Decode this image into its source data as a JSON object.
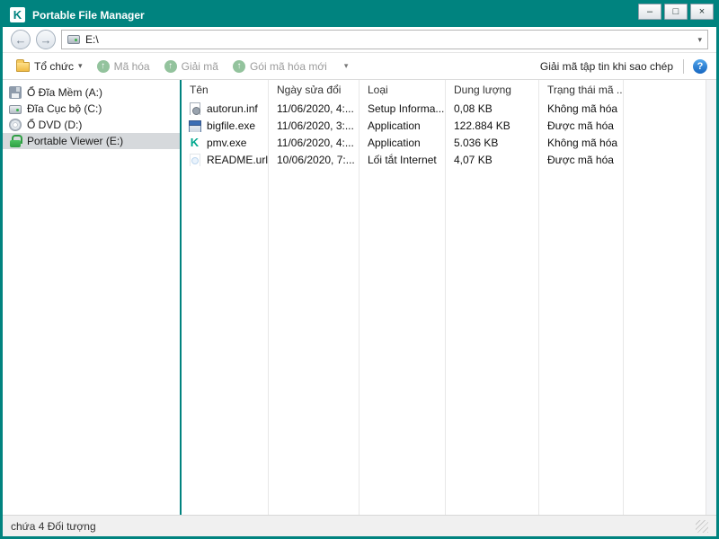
{
  "window": {
    "title": "Portable File Manager",
    "controls": {
      "minimize": "–",
      "maximize": "□",
      "close": "×"
    }
  },
  "icons": {
    "logo": "K",
    "back": "←",
    "forward": "→",
    "dropdown": "▾",
    "up_arrow": "↑",
    "help": "?"
  },
  "address_bar": {
    "path": "E:\\"
  },
  "toolbar": {
    "organize_label": "Tổ chức",
    "encrypt_label": "Mã hóa",
    "decrypt_label": "Giải mã",
    "new_package_label": "Gói mã hóa mới",
    "decrypt_on_copy_label": "Giải mã tập tin khi sao chép"
  },
  "sidebar": {
    "items": [
      {
        "label": "Ổ Đĩa Mềm (A:)",
        "icon": "floppy-drive-icon",
        "selected": false
      },
      {
        "label": "Đĩa Cục bộ (C:)",
        "icon": "hard-drive-icon",
        "selected": false
      },
      {
        "label": "Ổ DVD (D:)",
        "icon": "dvd-drive-icon",
        "selected": false
      },
      {
        "label": "Portable Viewer (E:)",
        "icon": "encrypted-drive-lock-icon",
        "selected": true
      }
    ]
  },
  "filelist": {
    "columns": [
      "Tên",
      "Ngày sửa đổi",
      "Loại",
      "Dung lượng",
      "Trạng thái mã ..."
    ],
    "rows": [
      {
        "name": "autorun.inf",
        "icon": "setup-file-icon",
        "modified": "11/06/2020, 4:...",
        "type": "Setup Informa...",
        "size": "0,08 KB",
        "status": "Không mã hóa"
      },
      {
        "name": "bigfile.exe",
        "icon": "application-file-icon",
        "modified": "11/06/2020, 3:...",
        "type": "Application",
        "size": "122.884 KB",
        "status": "Được mã hóa"
      },
      {
        "name": "pmv.exe",
        "icon": "kaspersky-app-icon",
        "modified": "11/06/2020, 4:...",
        "type": "Application",
        "size": "5.036 KB",
        "status": "Không mã hóa"
      },
      {
        "name": "README.url",
        "icon": "internet-shortcut-icon",
        "modified": "10/06/2020, 7:...",
        "type": "Lối tắt Internet",
        "size": "4,07 KB",
        "status": "Được mã hóa"
      }
    ]
  },
  "statusbar": {
    "text": "chứa 4 Đối tượng"
  },
  "colors": {
    "brand_teal": "#00837f",
    "kaspersky_green": "#00a88e",
    "help_blue": "#1f78d1",
    "selection_gray": "#d6d9dc"
  }
}
